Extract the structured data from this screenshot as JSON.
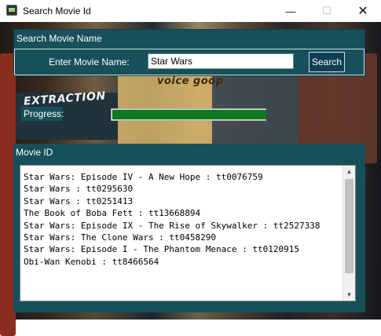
{
  "window": {
    "title": "Search Movie Id",
    "minimize_glyph": "—",
    "maximize_glyph": "☐",
    "close_glyph": "✕"
  },
  "background": {
    "texts": [
      "EXTRACTION",
      "voice goop"
    ]
  },
  "search": {
    "panel_title": "Search Movie Name",
    "label": "Enter Movie Name:",
    "value": "Star Wars",
    "button_label": "Search"
  },
  "progress": {
    "label": "Progress:",
    "fraction": 1.0,
    "color": "#0c7a1c"
  },
  "results": {
    "panel_title": "Movie ID",
    "items": [
      "Star Wars: Episode IV - A New Hope : tt0076759",
      "Star Wars : tt0295630",
      "Star Wars : tt0251413",
      "The Book of Boba Fett : tt13668894",
      "Star Wars: Episode IX - The Rise of Skywalker : tt2527338",
      "Star Wars: The Clone Wars : tt0458290",
      "Star Wars: Episode I - The Phantom Menace : tt0120915",
      "Obi-Wan Kenobi : tt8466564"
    ]
  },
  "colors": {
    "panel": "#18505a",
    "button": "#0f3f52"
  }
}
